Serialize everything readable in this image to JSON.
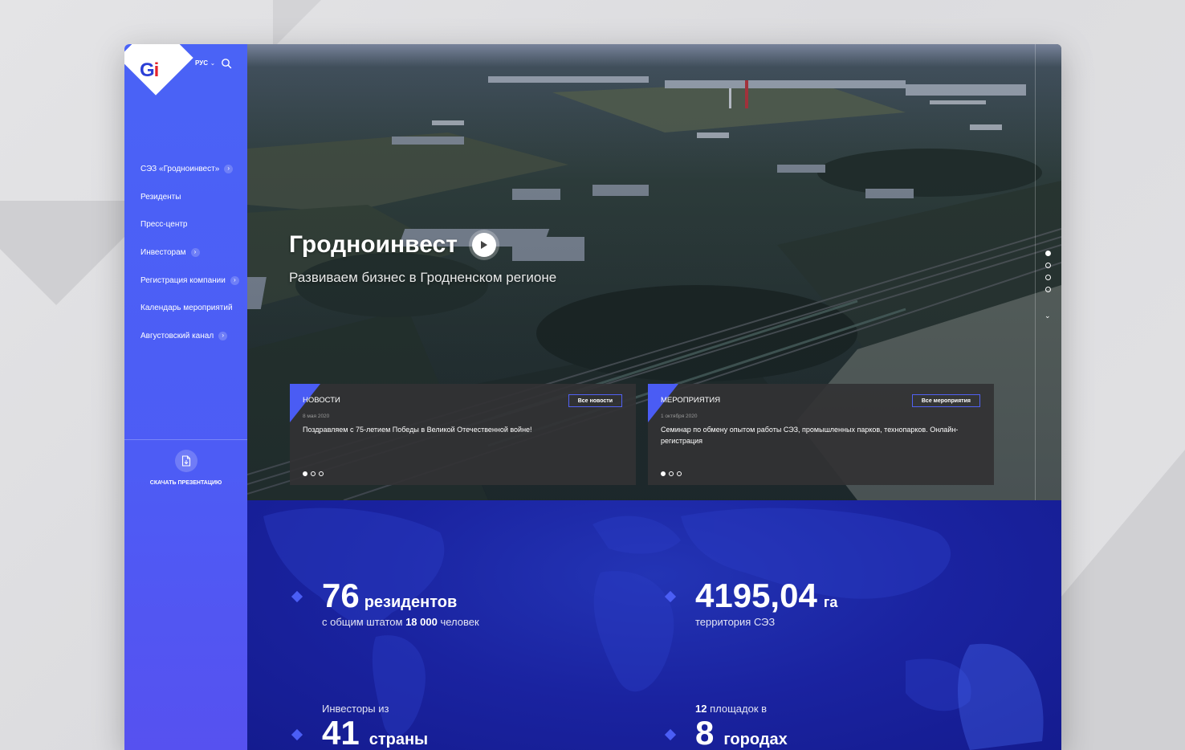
{
  "sidebar": {
    "logo": "Gi",
    "language": "РУС",
    "nav": [
      {
        "label": "СЭЗ «Гродноинвест»",
        "has_arrow": true
      },
      {
        "label": "Резиденты",
        "has_arrow": false
      },
      {
        "label": "Пресс-центр",
        "has_arrow": false
      },
      {
        "label": "Инвесторам",
        "has_arrow": true
      },
      {
        "label": "Регистрация компании",
        "has_arrow": true
      },
      {
        "label": "Календарь мероприятий",
        "has_arrow": false
      },
      {
        "label": "Августовский канал",
        "has_arrow": true
      }
    ],
    "download_label": "СКАЧАТЬ ПРЕЗЕНТАЦИЮ"
  },
  "hero": {
    "title": "Гродноинвест",
    "subtitle": "Развиваем бизнес в Гродненском регионе",
    "slides_count": 4,
    "active_slide": 0
  },
  "cards": [
    {
      "heading": "НОВОСТИ",
      "button": "Все новости",
      "date": "8 мая 2020",
      "text": "Поздравляем с 75-летием Победы в Великой Отечественной войне!",
      "dots": 3,
      "active_dot": 0
    },
    {
      "heading": "МЕРОПРИЯТИЯ",
      "button": "Все мероприятия",
      "date": "1 октября 2020",
      "text": "Семинар по обмену опытом работы СЭЗ, промышленных парков, технопарков. Онлайн-регистрация",
      "dots": 3,
      "active_dot": 0
    }
  ],
  "stats": {
    "residents": {
      "number": "76",
      "unit": "резидентов",
      "caption_pre": "с общим штатом",
      "caption_bold": "18 000",
      "caption_post": "человек"
    },
    "area": {
      "number": "4195,04",
      "unit": "га",
      "caption": "территория СЭЗ"
    },
    "investors": {
      "caption": "Инвесторы из",
      "number": "41",
      "unit": "страны"
    },
    "sites": {
      "caption_bold": "12",
      "caption": "площадок в",
      "number": "8",
      "unit": "городах"
    }
  },
  "colors": {
    "sidebar": "#4a63f6",
    "accent": "#4a5cf4",
    "stats_bg": "#1a23a0",
    "logo_red": "#e3232d"
  }
}
